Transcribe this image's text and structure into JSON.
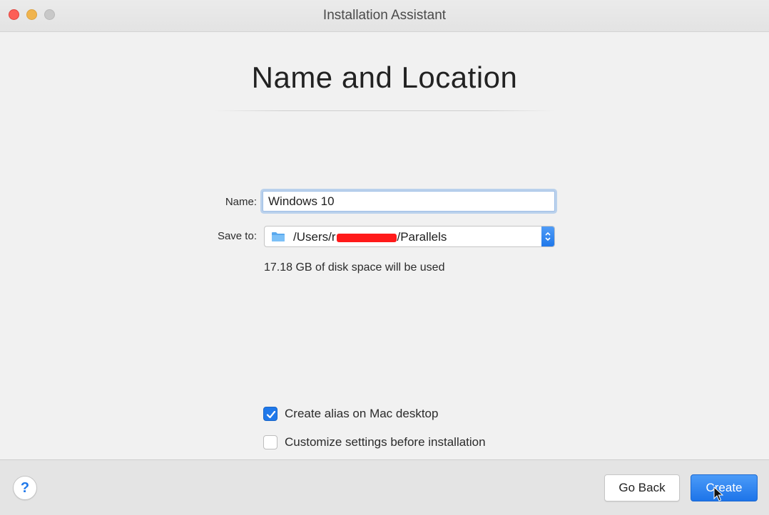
{
  "window": {
    "title": "Installation Assistant"
  },
  "page": {
    "heading": "Name and Location"
  },
  "form": {
    "name_label": "Name:",
    "name_value": "Windows 10",
    "save_label": "Save to:",
    "path_prefix": "/Users/r",
    "path_suffix": "/Parallels",
    "disk_info": "17.18 GB of disk space will be used"
  },
  "options": {
    "alias_label": "Create alias on Mac desktop",
    "alias_checked": true,
    "customize_label": "Customize settings before installation",
    "customize_checked": false
  },
  "footer": {
    "help_label": "?",
    "back_label": "Go Back",
    "create_label": "Create"
  },
  "colors": {
    "accent": "#1f78ea",
    "close": "#fc5f57",
    "minimize": "#f0b44e",
    "redaction": "#ff1a1a"
  },
  "icons": [
    "folder-icon",
    "stepper-icon",
    "checkmark-icon",
    "help-icon",
    "cursor-icon"
  ]
}
